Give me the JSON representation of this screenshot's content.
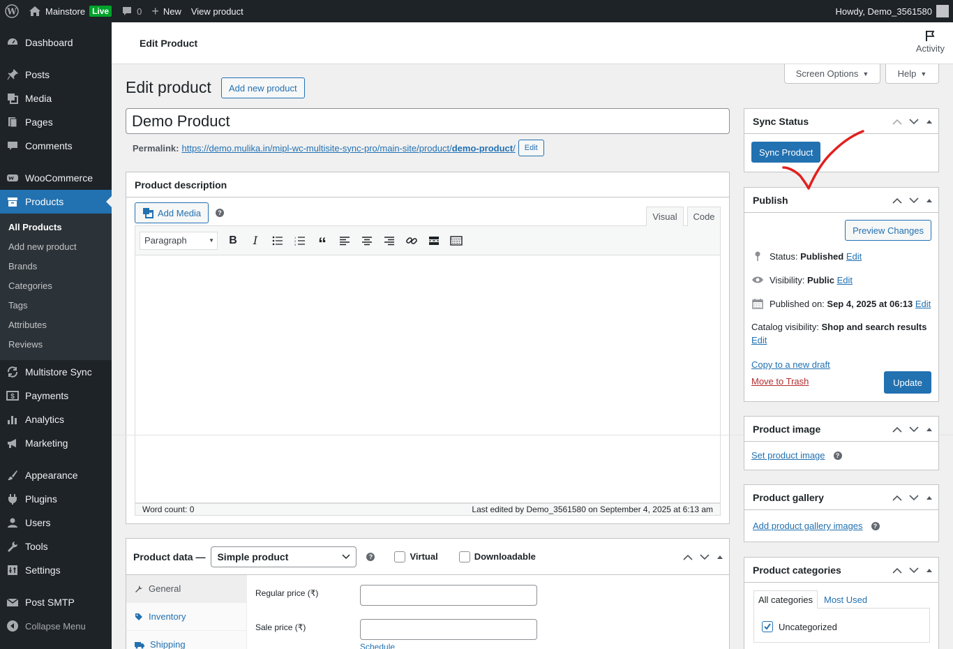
{
  "adminbar": {
    "site_name": "Mainstore",
    "live_badge": "Live",
    "comments_count": "0",
    "new_label": "New",
    "view_product": "View product",
    "howdy": "Howdy, Demo_3561580"
  },
  "sidebar": {
    "items": [
      {
        "label": "Dashboard",
        "icon": "dashboard-icon"
      },
      {
        "label": "Posts",
        "icon": "pin-icon"
      },
      {
        "label": "Media",
        "icon": "media-icon"
      },
      {
        "label": "Pages",
        "icon": "page-icon"
      },
      {
        "label": "Comments",
        "icon": "comment-icon"
      },
      {
        "label": "WooCommerce",
        "icon": "woo-icon"
      },
      {
        "label": "Products",
        "icon": "archive-icon"
      },
      {
        "label": "Multistore Sync",
        "icon": "sync-icon"
      },
      {
        "label": "Payments",
        "icon": "payments-icon"
      },
      {
        "label": "Analytics",
        "icon": "chart-icon"
      },
      {
        "label": "Marketing",
        "icon": "megaphone-icon"
      },
      {
        "label": "Appearance",
        "icon": "brush-icon"
      },
      {
        "label": "Plugins",
        "icon": "plugin-icon"
      },
      {
        "label": "Users",
        "icon": "user-icon"
      },
      {
        "label": "Tools",
        "icon": "wrench-icon"
      },
      {
        "label": "Settings",
        "icon": "settings-icon"
      },
      {
        "label": "Post SMTP",
        "icon": "email-icon"
      },
      {
        "label": "Collapse Menu",
        "icon": "collapse-icon"
      }
    ],
    "submenu": [
      "All Products",
      "Add new product",
      "Brands",
      "Categories",
      "Tags",
      "Attributes",
      "Reviews"
    ]
  },
  "header": {
    "title": "Edit Product",
    "activity": "Activity"
  },
  "screen_options": "Screen Options",
  "help": "Help",
  "page": {
    "heading": "Edit product",
    "add_new": "Add new product",
    "product_title": "Demo Product",
    "permalink_label": "Permalink:",
    "permalink_base": "https://demo.mulika.in/mipl-wc-multisite-sync-pro/main-site/product/",
    "permalink_slug": "demo-product",
    "permalink_end": "/",
    "permalink_edit": "Edit"
  },
  "description": {
    "title": "Product description",
    "add_media": "Add Media",
    "tab_visual": "Visual",
    "tab_code": "Code",
    "paragraph": "Paragraph",
    "word_count": "Word count: 0",
    "last_edited": "Last edited by Demo_3561580 on September 4, 2025 at 6:13 am"
  },
  "product_data": {
    "title": "Product data —",
    "type": "Simple product",
    "virtual": "Virtual",
    "downloadable": "Downloadable",
    "tabs": [
      "General",
      "Inventory",
      "Shipping"
    ],
    "regular_price": "Regular price (₹)",
    "sale_price": "Sale price (₹)",
    "schedule": "Schedule"
  },
  "sync_status": {
    "title": "Sync Status",
    "button": "Sync Product"
  },
  "publish": {
    "title": "Publish",
    "preview": "Preview Changes",
    "status_label": "Status:",
    "status_value": "Published",
    "visibility_label": "Visibility:",
    "visibility_value": "Public",
    "published_label": "Published on:",
    "published_value": "Sep 4, 2025 at 06:13",
    "catalog_label": "Catalog visibility:",
    "catalog_value": "Shop and search results",
    "edit": "Edit",
    "copy_draft": "Copy to a new draft",
    "trash": "Move to Trash",
    "update": "Update"
  },
  "product_image": {
    "title": "Product image",
    "link": "Set product image"
  },
  "product_gallery": {
    "title": "Product gallery",
    "link": "Add product gallery images"
  },
  "product_categories": {
    "title": "Product categories",
    "tab_all": "All categories",
    "tab_most": "Most Used",
    "category": "Uncategorized"
  },
  "colors": {
    "accent": "#2271b1",
    "adminbar": "#1d2327",
    "trash": "#b32d2e",
    "annotation": "#e0201e"
  }
}
